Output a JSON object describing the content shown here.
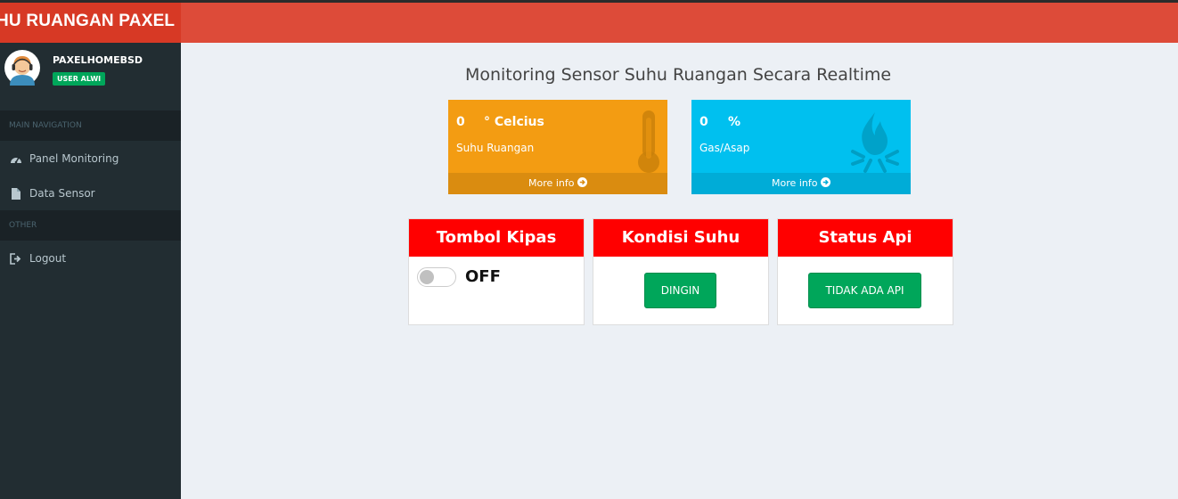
{
  "header": {
    "logo_text": "HU RUANGAN PAXEL"
  },
  "user": {
    "name": "PAXELHOMEBSD",
    "badge": "USER ALWI"
  },
  "nav": {
    "main_header": "MAIN NAVIGATION",
    "items": [
      {
        "label": "Panel Monitoring",
        "icon": "dashboard-icon"
      },
      {
        "label": "Data Sensor",
        "icon": "file-icon"
      }
    ],
    "other_header": "OTHER",
    "other_items": [
      {
        "label": "Logout",
        "icon": "sign-out-icon"
      }
    ]
  },
  "page": {
    "title": "Monitoring Sensor Suhu Ruangan Secara Realtime"
  },
  "boxes": [
    {
      "value": "0",
      "unit": "° Celcius",
      "label": "Suhu Ruangan",
      "more": "More info",
      "icon": "thermometer-icon",
      "color": "#f39c12"
    },
    {
      "value": "0",
      "unit": "%",
      "label": "Gas/Asap",
      "more": "More info",
      "icon": "fire-icon",
      "color": "#00c0ef"
    }
  ],
  "panels": {
    "fan": {
      "title": "Tombol Kipas",
      "state": "OFF"
    },
    "temp": {
      "title": "Kondisi Suhu",
      "status": "DINGIN"
    },
    "fire": {
      "title": "Status Api",
      "status": "TIDAK ADA API"
    }
  },
  "colors": {
    "header": "#dd4b39",
    "sidebar": "#222d32",
    "panel_header": "#ff0000",
    "success": "#00a65a"
  }
}
